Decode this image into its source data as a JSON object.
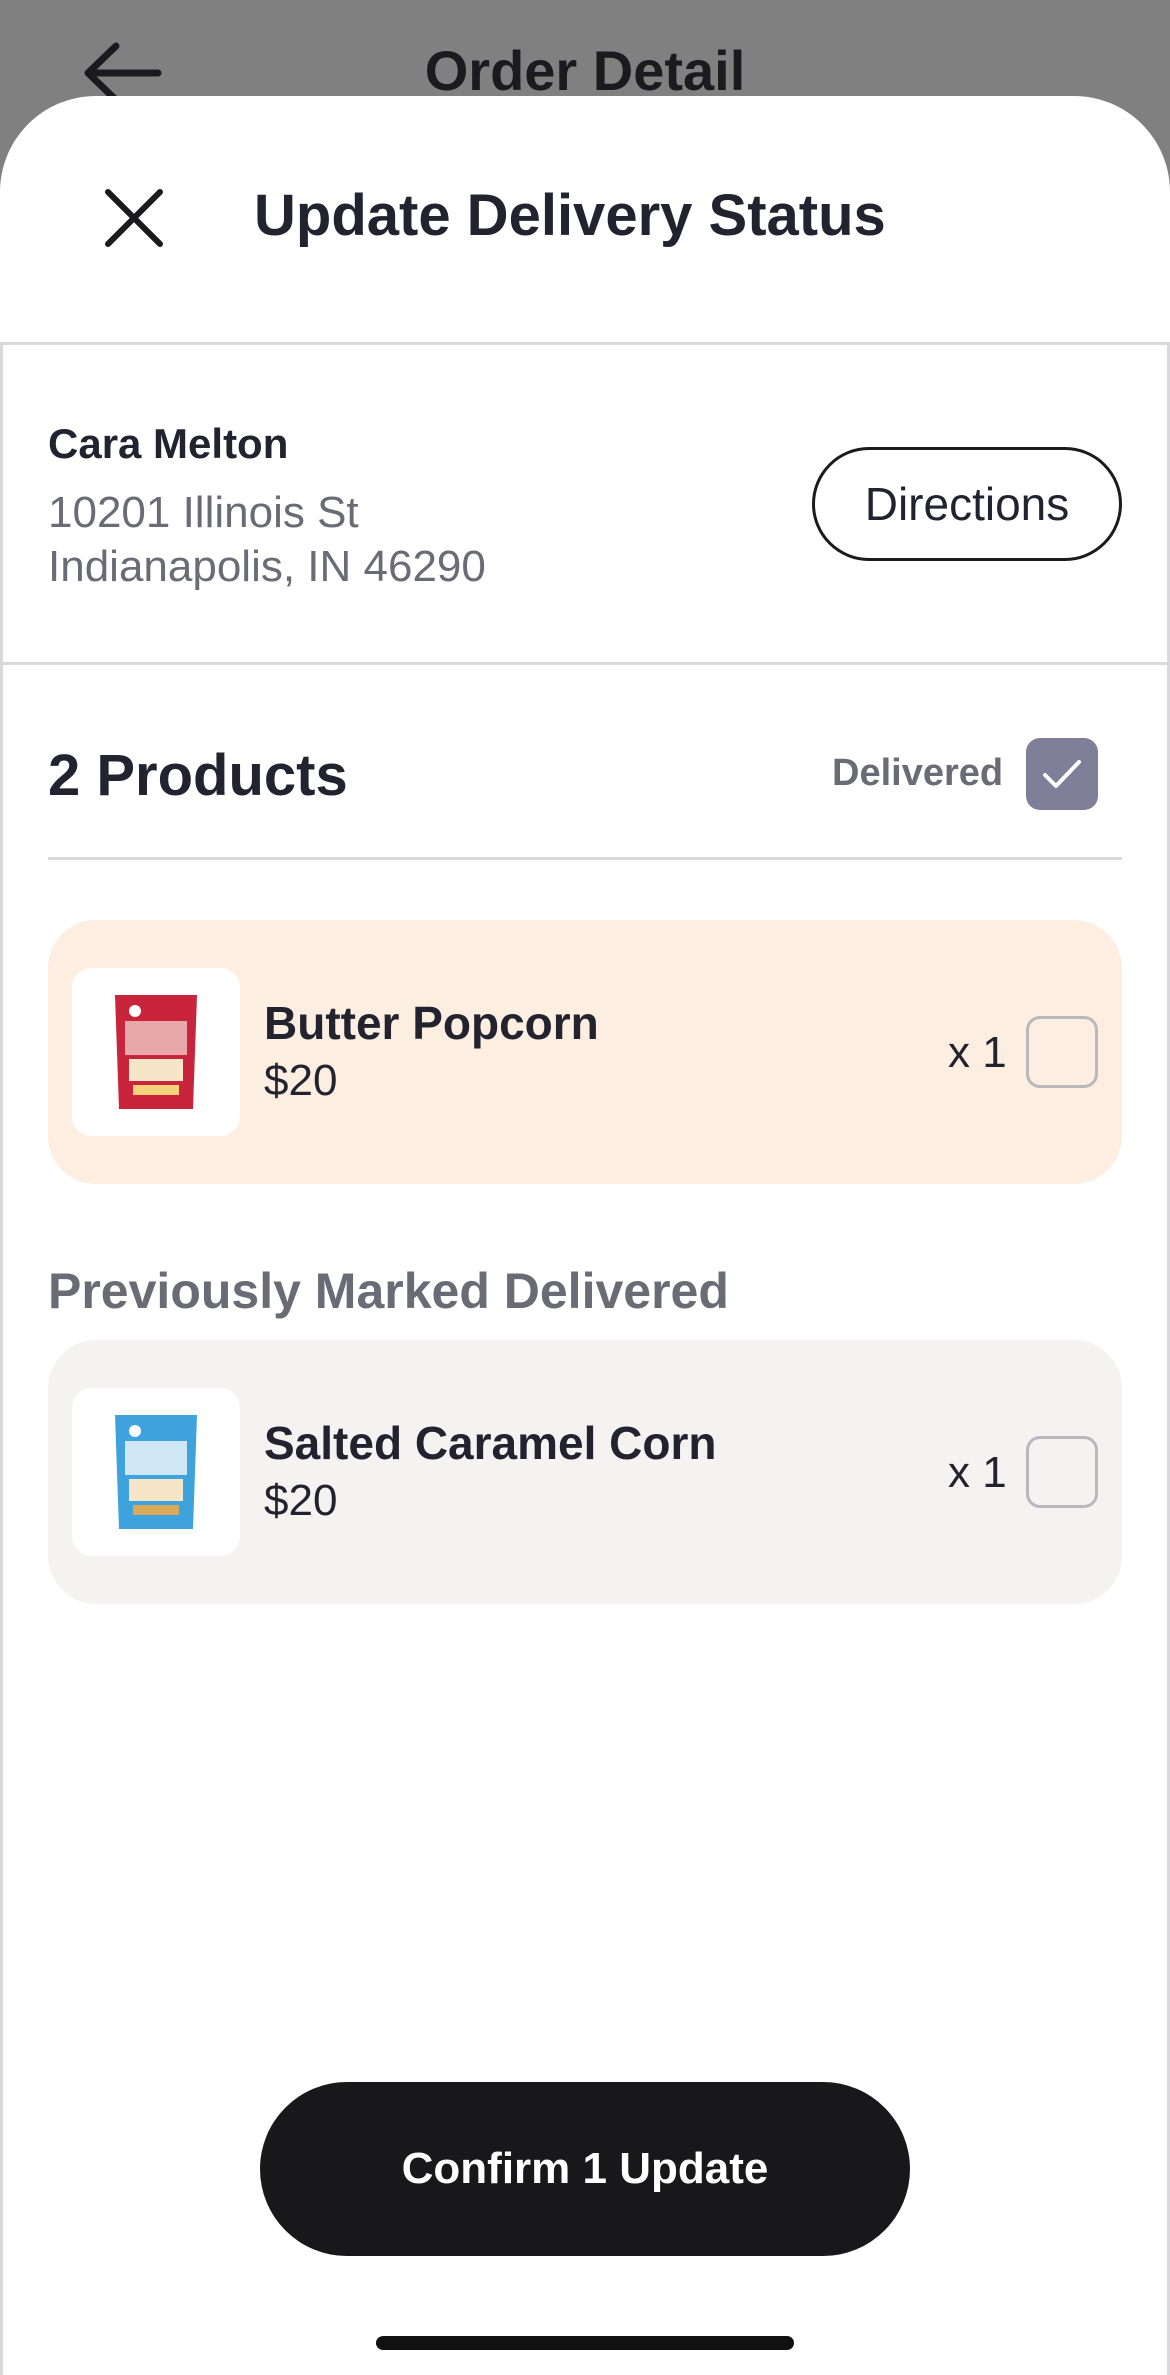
{
  "background": {
    "title": "Order Detail",
    "back_icon": "arrow-left-icon"
  },
  "sheet": {
    "title": "Update Delivery Status",
    "close_icon": "close-icon"
  },
  "customer": {
    "name": "Cara Melton",
    "address_line1": "10201 Illinois St",
    "address_line2": "Indianapolis, IN 46290",
    "directions_label": "Directions"
  },
  "products": {
    "title": "2 Products",
    "delivered_label": "Delivered",
    "delivered_checked": true,
    "items": [
      {
        "name": "Butter Popcorn",
        "price": "$20",
        "qty": "x 1",
        "checked": false,
        "thumb_color": "#c8243c"
      }
    ]
  },
  "previous": {
    "label": "Previously Marked Delivered",
    "items": [
      {
        "name": "Salted Caramel Corn",
        "price": "$20",
        "qty": "x 1",
        "checked": false,
        "thumb_color": "#3ea2dd"
      }
    ]
  },
  "footer": {
    "confirm_label": "Confirm 1 Update"
  },
  "colors": {
    "accent_checkbox": "#7f7f99",
    "highlight_card": "#fdeee2",
    "muted_card": "#f4f3f2",
    "primary_button": "#18181b"
  }
}
